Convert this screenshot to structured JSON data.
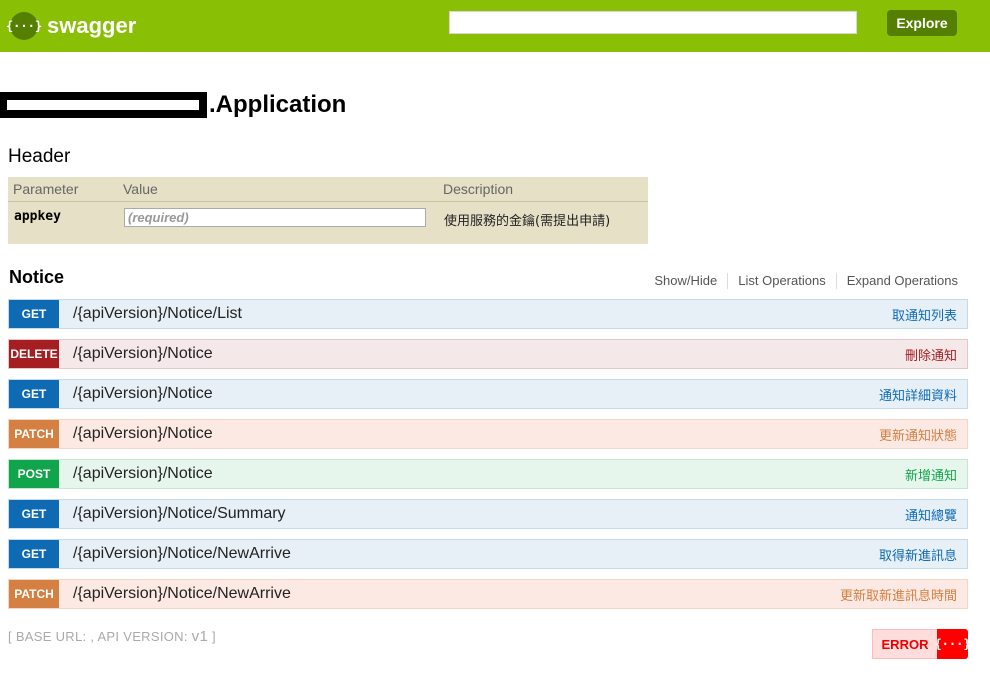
{
  "header": {
    "logo_glyph": "{···}",
    "logo_text": "swagger",
    "url_value": "",
    "explore_label": "Explore"
  },
  "api": {
    "title_suffix": ".Application"
  },
  "params": {
    "section_title": "Header",
    "columns": [
      "Parameter",
      "Value",
      "Description"
    ],
    "rows": [
      {
        "name": "appkey",
        "placeholder": "(required)",
        "description": "使用服務的金鑰(需提出申請)"
      }
    ]
  },
  "resource": {
    "name": "Notice",
    "links": [
      "Show/Hide",
      "List Operations",
      "Expand Operations"
    ]
  },
  "operations": [
    {
      "method": "GET",
      "path": "/{apiVersion}/Notice/List",
      "summary": "取通知列表"
    },
    {
      "method": "DELETE",
      "path": "/{apiVersion}/Notice",
      "summary": "刪除通知"
    },
    {
      "method": "GET",
      "path": "/{apiVersion}/Notice",
      "summary": "通知詳細資料"
    },
    {
      "method": "PATCH",
      "path": "/{apiVersion}/Notice",
      "summary": "更新通知狀態"
    },
    {
      "method": "POST",
      "path": "/{apiVersion}/Notice",
      "summary": "新增通知"
    },
    {
      "method": "GET",
      "path": "/{apiVersion}/Notice/Summary",
      "summary": "通知總覽"
    },
    {
      "method": "GET",
      "path": "/{apiVersion}/Notice/NewArrive",
      "summary": "取得新進訊息"
    },
    {
      "method": "PATCH",
      "path": "/{apiVersion}/Notice/NewArrive",
      "summary": "更新取新進訊息時間"
    }
  ],
  "footer": {
    "base_url_label": "[ BASE URL: , API VERSION: ",
    "api_version": "v1",
    "close_bracket": " ]",
    "error_label": "ERROR",
    "error_glyph": "{···}"
  },
  "colors": {
    "topbar": "#89bf04",
    "get": "#0f6ab4",
    "delete": "#a41e22",
    "patch": "#d38042",
    "post": "#10a54a"
  }
}
